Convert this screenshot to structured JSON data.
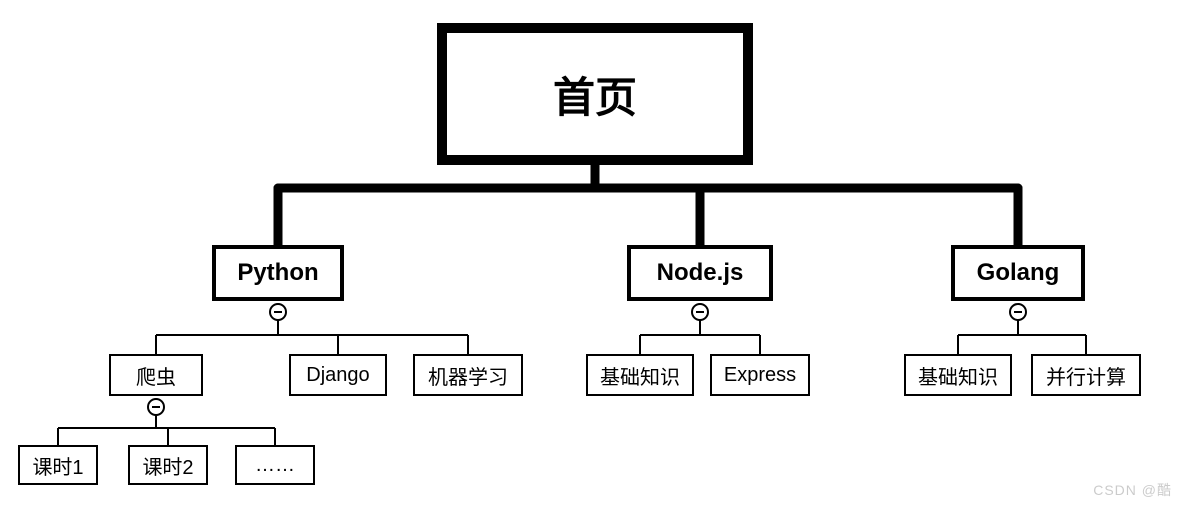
{
  "root": {
    "label": "首页"
  },
  "level1": {
    "python": {
      "label": "Python"
    },
    "nodejs": {
      "label": "Node.js"
    },
    "golang": {
      "label": "Golang"
    }
  },
  "level2": {
    "python_crawler": {
      "label": "爬虫"
    },
    "python_django": {
      "label": "Django"
    },
    "python_ml": {
      "label": "机器学习"
    },
    "node_basics": {
      "label": "基础知识"
    },
    "node_express": {
      "label": "Express"
    },
    "go_basics": {
      "label": "基础知识"
    },
    "go_parallel": {
      "label": "并行计算"
    }
  },
  "level3": {
    "lesson1": {
      "label": "课时1"
    },
    "lesson2": {
      "label": "课时2"
    },
    "ellipsis": {
      "label": "……"
    }
  },
  "watermark": "CSDN @酷"
}
